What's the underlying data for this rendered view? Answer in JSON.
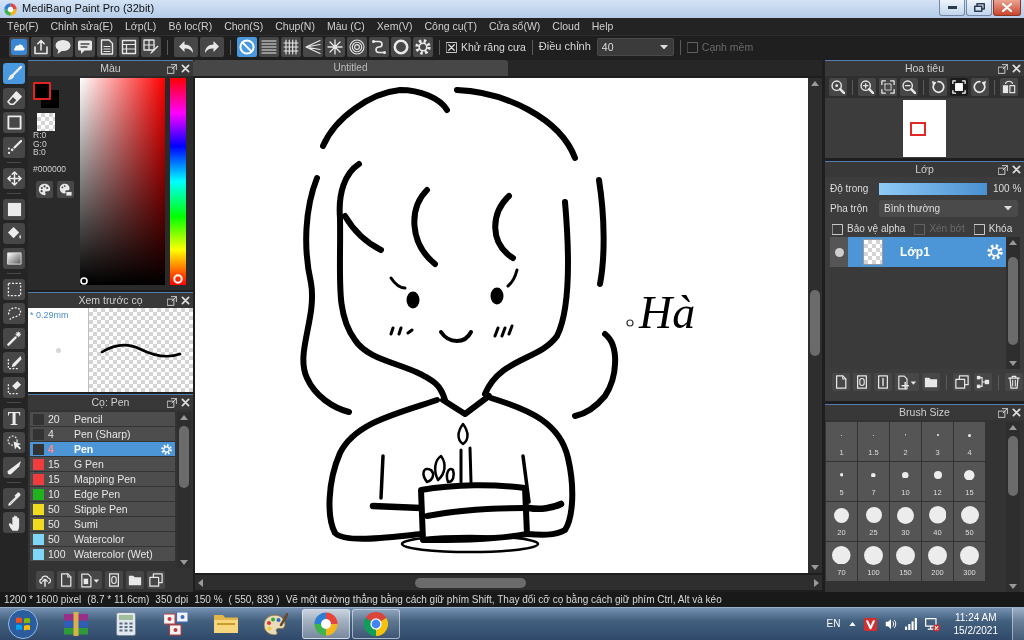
{
  "window": {
    "title": "MediBang Paint Pro (32bit)"
  },
  "menu": [
    "Tệp(F)",
    "Chỉnh sửa(E)",
    "Lớp(L)",
    "Bộ lọc(R)",
    "Chọn(S)",
    "Chụp(N)",
    "Màu (C)",
    "Xem(V)",
    "Công cụ(T)",
    "Cửa sổ(W)",
    "Cloud",
    "Help"
  ],
  "toolbar": {
    "snap_buttons": [
      {
        "selected": true
      },
      {
        "selected": false
      },
      {
        "selected": false
      },
      {
        "selected": false
      },
      {
        "selected": false
      },
      {
        "selected": false
      },
      {
        "selected": false
      },
      {
        "selected": false
      },
      {
        "selected": false
      }
    ],
    "antialias": {
      "label": "Khử răng cưa",
      "checked": true,
      "disabled": false
    },
    "correction": {
      "label": "Điều chỉnh",
      "value": "40"
    },
    "soft_edge": {
      "label": "Cạnh mềm",
      "checked": false,
      "disabled": true
    }
  },
  "tools": [
    {
      "selected": true
    },
    {
      "selected": false
    },
    {
      "selected": false
    },
    {
      "selected": false
    },
    {
      "selected": false
    },
    {
      "selected": false
    },
    {
      "selected": false
    },
    {
      "selected": false
    },
    {
      "selected": false
    },
    {
      "selected": false
    },
    {
      "selected": false
    },
    {
      "selected": false
    },
    {
      "selected": false
    },
    {
      "selected": false,
      "glyph": "T"
    },
    {
      "selected": false
    },
    {
      "selected": false
    },
    {
      "selected": false
    },
    {
      "selected": false
    }
  ],
  "color_panel": {
    "title": "Màu",
    "rgb": [
      "R:0",
      "G:0",
      "B:0"
    ],
    "hex": "#000000",
    "hue_slider": {
      "level": 0
    }
  },
  "brush_preview": {
    "title": "Xem trước cọ",
    "size": "* 0.29mm"
  },
  "brush_panel": {
    "title": "Cọ: Pen",
    "brushes": [
      {
        "size": "20",
        "name": "Pencil",
        "color": "#333333",
        "selected": false
      },
      {
        "size": "4",
        "name": "Pen (Sharp)",
        "color": "#333333",
        "selected": false
      },
      {
        "size": "4",
        "name": "Pen",
        "color": "#333333",
        "selected": true
      },
      {
        "size": "15",
        "name": "G Pen",
        "color": "#f03c3c",
        "selected": false
      },
      {
        "size": "15",
        "name": "Mapping Pen",
        "color": "#f03c3c",
        "selected": false
      },
      {
        "size": "10",
        "name": "Edge Pen",
        "color": "#1fb21f",
        "selected": false
      },
      {
        "size": "50",
        "name": "Stipple Pen",
        "color": "#f0dc1e",
        "selected": false
      },
      {
        "size": "50",
        "name": "Sumi",
        "color": "#f0dc1e",
        "selected": false
      },
      {
        "size": "50",
        "name": "Watercolor",
        "color": "#7fd6f6",
        "selected": false
      },
      {
        "size": "100",
        "name": "Watercolor (Wet)",
        "color": "#7fd6f6",
        "selected": false
      }
    ]
  },
  "canvas": {
    "tab": "Untitled",
    "signature": "Hà"
  },
  "navigator": {
    "title": "Hoa tiêu",
    "buttons": [
      {
        "selected": false
      },
      {
        "selected": false
      },
      {
        "selected": false
      },
      {
        "selected": false
      },
      {
        "selected": false
      },
      {
        "selected": true
      },
      {
        "selected": false
      },
      {
        "selected": false
      }
    ]
  },
  "layers_panel": {
    "title": "Lớp",
    "opacity": {
      "label": "Độ trong",
      "level": 1,
      "reading": "100 %"
    },
    "blend": {
      "label": "Pha trộn",
      "value": "Bình thường"
    },
    "options": [
      {
        "label": "Bảo vệ alpha",
        "checked": false,
        "disabled": false
      },
      {
        "label": "Xén bớt",
        "checked": false,
        "disabled": true
      },
      {
        "label": "Khóa",
        "checked": false,
        "disabled": false
      }
    ],
    "layers": [
      {
        "name": "Lớp1",
        "visible": true,
        "selected": true
      }
    ]
  },
  "brush_size": {
    "title": "Brush Size",
    "sizes": [
      "1",
      "1.5",
      "2",
      "3",
      "4",
      "5",
      "7",
      "10",
      "12",
      "15",
      "20",
      "25",
      "30",
      "40",
      "50",
      "70",
      "100",
      "150",
      "200",
      "300"
    ]
  },
  "status_bar": [
    "1200 * 1600 pixel",
    "(8.7 * 11.6cm)",
    "350 dpi",
    "150 %",
    "( 550, 839 )",
    "Vẽ một đường thẳng bằng cách giữ phím Shift, Thay đổi cỡ cọ bằng cách giữ phím Ctrl, Alt và kéo"
  ],
  "taskbar": {
    "apps": [
      {
        "running": false,
        "selected": false
      },
      {
        "running": false,
        "selected": false
      },
      {
        "running": false,
        "selected": false
      },
      {
        "running": false,
        "selected": false
      },
      {
        "running": false,
        "selected": false
      },
      {
        "running": true,
        "selected": true
      },
      {
        "running": true,
        "selected": false
      }
    ],
    "language": "EN",
    "time": "11:24 AM",
    "date": "15/2/2021"
  }
}
